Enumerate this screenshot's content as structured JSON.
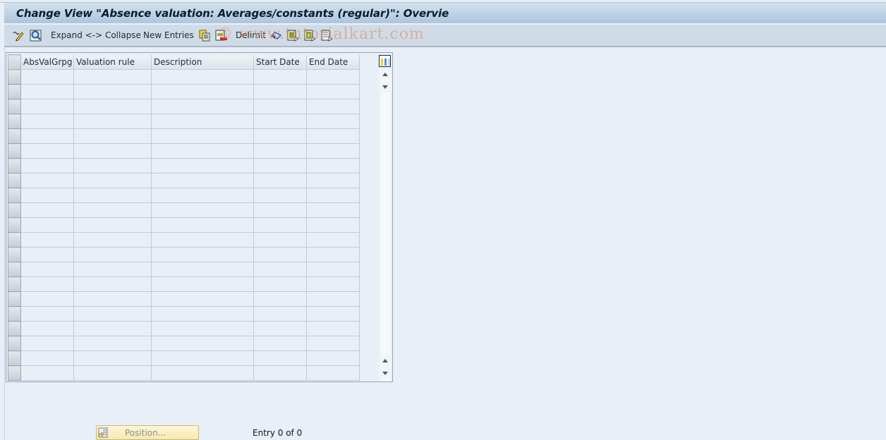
{
  "window": {
    "title": "Change View \"Absence valuation: Averages/constants (regular)\": Overvie"
  },
  "toolbar": {
    "items": [
      {
        "type": "icon",
        "icon": "display-change-icon"
      },
      {
        "type": "icon",
        "icon": "details-icon"
      },
      {
        "type": "text",
        "label": "Expand <-> Collapse"
      },
      {
        "type": "text",
        "label": "New Entries"
      },
      {
        "type": "icon",
        "icon": "copy-as-icon"
      },
      {
        "type": "icon",
        "icon": "delete-icon"
      },
      {
        "type": "text",
        "label": "Delimit"
      },
      {
        "type": "icon",
        "icon": "undo-change-icon"
      },
      {
        "type": "icon",
        "icon": "select-all-icon"
      },
      {
        "type": "icon",
        "icon": "select-block-icon"
      },
      {
        "type": "icon",
        "icon": "deselect-all-icon"
      }
    ],
    "expand_collapse_label": "Expand <-> Collapse",
    "new_entries_label": "New Entries",
    "delimit_label": "Delimit"
  },
  "watermark": "© www.tutorialkart.com",
  "table": {
    "columns": [
      "AbsValGrpg",
      "Valuation rule",
      "Description",
      "Start Date",
      "End Date"
    ],
    "rows": [],
    "visible_empty_rows": 21
  },
  "footer": {
    "position_button_label": "Position...",
    "entry_status": "Entry 0 of 0"
  }
}
